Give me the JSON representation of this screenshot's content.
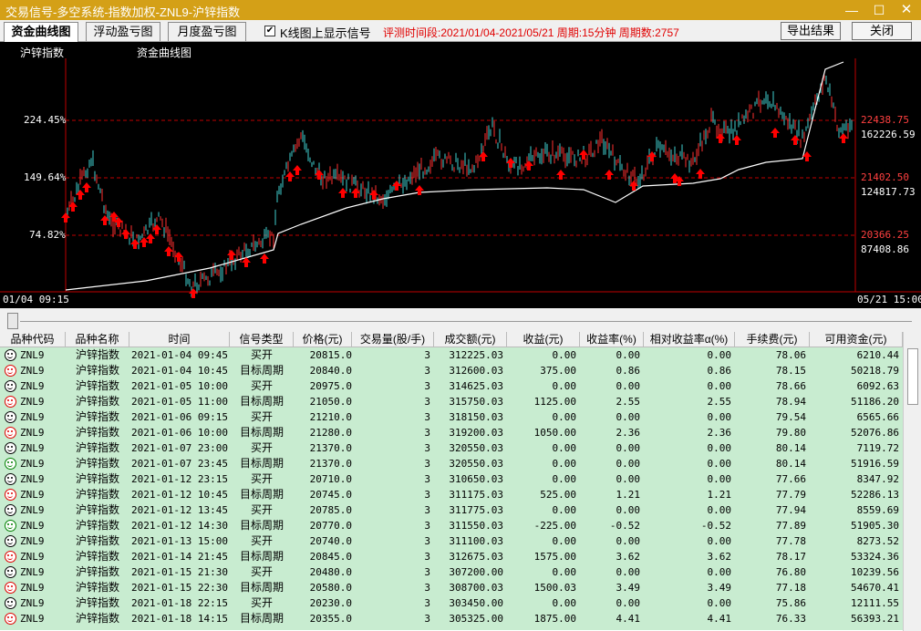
{
  "window": {
    "title": "交易信号-多空系统-指数加权-ZNL9-沪锌指数"
  },
  "toolbar": {
    "tabs": [
      "资金曲线图",
      "浮动盈亏图",
      "月度盈亏图"
    ],
    "checkbox_label": "K线图上显示信号",
    "checkbox_checked": true,
    "info": "评测时间段:2021/01/04-2021/05/21 周期:15分钟 周期数:2757",
    "export_label": "导出结果",
    "close_label": "关闭"
  },
  "chart": {
    "instrument_label": "沪锌指数",
    "curve_label": "资金曲线图",
    "left_axis": [
      "224.45%",
      "149.64%",
      "74.82%"
    ],
    "right_price": [
      "22438.75",
      "21402.50",
      "20366.25"
    ],
    "right_equity": [
      "162226.59",
      "124817.73",
      "87408.86"
    ],
    "start_time": "01/04 09:15",
    "end_time": "05/21 15:00",
    "colors": {
      "bg": "#000000",
      "grid": "#c00000",
      "up": "#ff3030",
      "down": "#40d0d0",
      "equity": "#ffffff",
      "signal": "#ff0000"
    }
  },
  "table": {
    "columns": [
      "品种代码",
      "品种名称",
      "时间",
      "信号类型",
      "价格(元)",
      "交易量(股/手)",
      "成交额(元)",
      "收益(元)",
      "收益率(%)",
      "相对收益率α(%)",
      "手续费(元)",
      "可用资金(元)"
    ],
    "rows": [
      {
        "face": "black",
        "code": "ZNL9",
        "name": "沪锌指数",
        "time": "2021-01-04 09:45",
        "type": "买开",
        "price": "20815.0",
        "vol": "3",
        "amount": "312225.03",
        "pnl": "0.00",
        "ret": "0.00",
        "alpha": "0.00",
        "fee": "78.06",
        "cash": "6210.44"
      },
      {
        "face": "red",
        "code": "ZNL9",
        "name": "沪锌指数",
        "time": "2021-01-04 10:45",
        "type": "目标周期",
        "price": "20840.0",
        "vol": "3",
        "amount": "312600.03",
        "pnl": "375.00",
        "ret": "0.86",
        "alpha": "0.86",
        "fee": "78.15",
        "cash": "50218.79"
      },
      {
        "face": "black",
        "code": "ZNL9",
        "name": "沪锌指数",
        "time": "2021-01-05 10:00",
        "type": "买开",
        "price": "20975.0",
        "vol": "3",
        "amount": "314625.03",
        "pnl": "0.00",
        "ret": "0.00",
        "alpha": "0.00",
        "fee": "78.66",
        "cash": "6092.63"
      },
      {
        "face": "red",
        "code": "ZNL9",
        "name": "沪锌指数",
        "time": "2021-01-05 11:00",
        "type": "目标周期",
        "price": "21050.0",
        "vol": "3",
        "amount": "315750.03",
        "pnl": "1125.00",
        "ret": "2.55",
        "alpha": "2.55",
        "fee": "78.94",
        "cash": "51186.20"
      },
      {
        "face": "black",
        "code": "ZNL9",
        "name": "沪锌指数",
        "time": "2021-01-06 09:15",
        "type": "买开",
        "price": "21210.0",
        "vol": "3",
        "amount": "318150.03",
        "pnl": "0.00",
        "ret": "0.00",
        "alpha": "0.00",
        "fee": "79.54",
        "cash": "6565.66"
      },
      {
        "face": "red",
        "code": "ZNL9",
        "name": "沪锌指数",
        "time": "2021-01-06 10:00",
        "type": "目标周期",
        "price": "21280.0",
        "vol": "3",
        "amount": "319200.03",
        "pnl": "1050.00",
        "ret": "2.36",
        "alpha": "2.36",
        "fee": "79.80",
        "cash": "52076.86"
      },
      {
        "face": "black",
        "code": "ZNL9",
        "name": "沪锌指数",
        "time": "2021-01-07 23:00",
        "type": "买开",
        "price": "21370.0",
        "vol": "3",
        "amount": "320550.03",
        "pnl": "0.00",
        "ret": "0.00",
        "alpha": "0.00",
        "fee": "80.14",
        "cash": "7119.72"
      },
      {
        "face": "green",
        "code": "ZNL9",
        "name": "沪锌指数",
        "time": "2021-01-07 23:45",
        "type": "目标周期",
        "price": "21370.0",
        "vol": "3",
        "amount": "320550.03",
        "pnl": "0.00",
        "ret": "0.00",
        "alpha": "0.00",
        "fee": "80.14",
        "cash": "51916.59"
      },
      {
        "face": "black",
        "code": "ZNL9",
        "name": "沪锌指数",
        "time": "2021-01-12 23:15",
        "type": "买开",
        "price": "20710.0",
        "vol": "3",
        "amount": "310650.03",
        "pnl": "0.00",
        "ret": "0.00",
        "alpha": "0.00",
        "fee": "77.66",
        "cash": "8347.92"
      },
      {
        "face": "red",
        "code": "ZNL9",
        "name": "沪锌指数",
        "time": "2021-01-12 10:45",
        "type": "目标周期",
        "price": "20745.0",
        "vol": "3",
        "amount": "311175.03",
        "pnl": "525.00",
        "ret": "1.21",
        "alpha": "1.21",
        "fee": "77.79",
        "cash": "52286.13"
      },
      {
        "face": "black",
        "code": "ZNL9",
        "name": "沪锌指数",
        "time": "2021-01-12 13:45",
        "type": "买开",
        "price": "20785.0",
        "vol": "3",
        "amount": "311775.03",
        "pnl": "0.00",
        "ret": "0.00",
        "alpha": "0.00",
        "fee": "77.94",
        "cash": "8559.69"
      },
      {
        "face": "green",
        "code": "ZNL9",
        "name": "沪锌指数",
        "time": "2021-01-12 14:30",
        "type": "目标周期",
        "price": "20770.0",
        "vol": "3",
        "amount": "311550.03",
        "pnl": "-225.00",
        "ret": "-0.52",
        "alpha": "-0.52",
        "fee": "77.89",
        "cash": "51905.30"
      },
      {
        "face": "black",
        "code": "ZNL9",
        "name": "沪锌指数",
        "time": "2021-01-13 15:00",
        "type": "买开",
        "price": "20740.0",
        "vol": "3",
        "amount": "311100.03",
        "pnl": "0.00",
        "ret": "0.00",
        "alpha": "0.00",
        "fee": "77.78",
        "cash": "8273.52"
      },
      {
        "face": "red",
        "code": "ZNL9",
        "name": "沪锌指数",
        "time": "2021-01-14 21:45",
        "type": "目标周期",
        "price": "20845.0",
        "vol": "3",
        "amount": "312675.03",
        "pnl": "1575.00",
        "ret": "3.62",
        "alpha": "3.62",
        "fee": "78.17",
        "cash": "53324.36"
      },
      {
        "face": "black",
        "code": "ZNL9",
        "name": "沪锌指数",
        "time": "2021-01-15 21:30",
        "type": "买开",
        "price": "20480.0",
        "vol": "3",
        "amount": "307200.00",
        "pnl": "0.00",
        "ret": "0.00",
        "alpha": "0.00",
        "fee": "76.80",
        "cash": "10239.56"
      },
      {
        "face": "red",
        "code": "ZNL9",
        "name": "沪锌指数",
        "time": "2021-01-15 22:30",
        "type": "目标周期",
        "price": "20580.0",
        "vol": "3",
        "amount": "308700.03",
        "pnl": "1500.03",
        "ret": "3.49",
        "alpha": "3.49",
        "fee": "77.18",
        "cash": "54670.41"
      },
      {
        "face": "black",
        "code": "ZNL9",
        "name": "沪锌指数",
        "time": "2021-01-18 22:15",
        "type": "买开",
        "price": "20230.0",
        "vol": "3",
        "amount": "303450.00",
        "pnl": "0.00",
        "ret": "0.00",
        "alpha": "0.00",
        "fee": "75.86",
        "cash": "12111.55"
      },
      {
        "face": "red",
        "code": "ZNL9",
        "name": "沪锌指数",
        "time": "2021-01-18 14:15",
        "type": "目标周期",
        "price": "20355.0",
        "vol": "3",
        "amount": "305325.00",
        "pnl": "1875.00",
        "ret": "4.41",
        "alpha": "4.41",
        "fee": "76.33",
        "cash": "56393.21"
      }
    ]
  }
}
